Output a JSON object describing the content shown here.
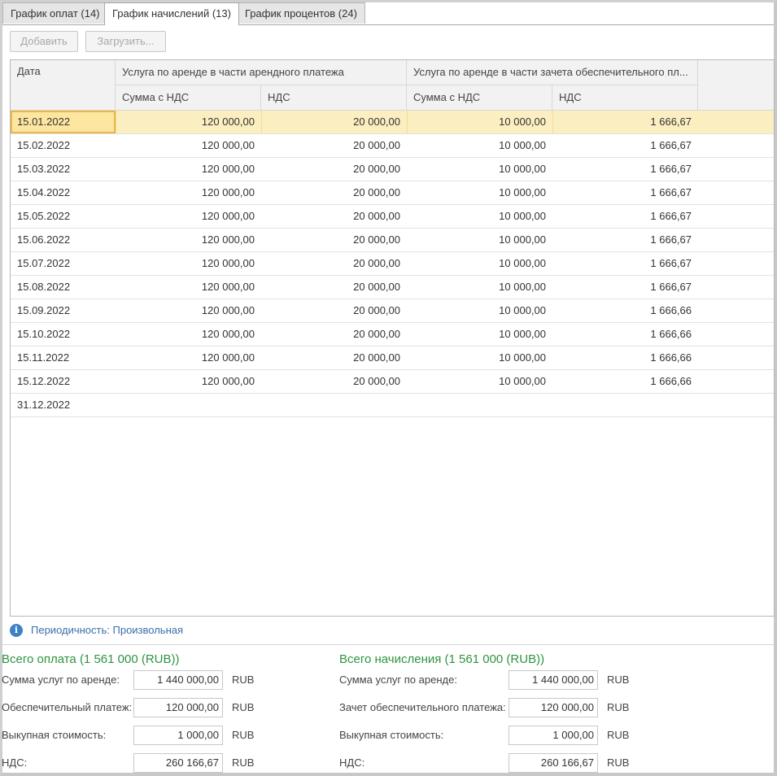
{
  "tabs": [
    {
      "label": "График оплат (14)",
      "active": false
    },
    {
      "label": "График начислений (13)",
      "active": true
    },
    {
      "label": "График процентов (24)",
      "active": false
    }
  ],
  "toolbar": {
    "add_label": "Добавить",
    "load_label": "Загрузить..."
  },
  "table": {
    "header": {
      "date": "Дата",
      "group1": "Услуга по аренде в части арендного платежа",
      "group2": "Услуга по аренде в части зачета обеспечительного пл...",
      "sum_vat": "Сумма с НДС",
      "vat": "НДС"
    },
    "rows": [
      {
        "date": "15.01.2022",
        "c1": "120 000,00",
        "c2": "20 000,00",
        "c3": "10 000,00",
        "c4": "1 666,67"
      },
      {
        "date": "15.02.2022",
        "c1": "120 000,00",
        "c2": "20 000,00",
        "c3": "10 000,00",
        "c4": "1 666,67"
      },
      {
        "date": "15.03.2022",
        "c1": "120 000,00",
        "c2": "20 000,00",
        "c3": "10 000,00",
        "c4": "1 666,67"
      },
      {
        "date": "15.04.2022",
        "c1": "120 000,00",
        "c2": "20 000,00",
        "c3": "10 000,00",
        "c4": "1 666,67"
      },
      {
        "date": "15.05.2022",
        "c1": "120 000,00",
        "c2": "20 000,00",
        "c3": "10 000,00",
        "c4": "1 666,67"
      },
      {
        "date": "15.06.2022",
        "c1": "120 000,00",
        "c2": "20 000,00",
        "c3": "10 000,00",
        "c4": "1 666,67"
      },
      {
        "date": "15.07.2022",
        "c1": "120 000,00",
        "c2": "20 000,00",
        "c3": "10 000,00",
        "c4": "1 666,67"
      },
      {
        "date": "15.08.2022",
        "c1": "120 000,00",
        "c2": "20 000,00",
        "c3": "10 000,00",
        "c4": "1 666,67"
      },
      {
        "date": "15.09.2022",
        "c1": "120 000,00",
        "c2": "20 000,00",
        "c3": "10 000,00",
        "c4": "1 666,66"
      },
      {
        "date": "15.10.2022",
        "c1": "120 000,00",
        "c2": "20 000,00",
        "c3": "10 000,00",
        "c4": "1 666,66"
      },
      {
        "date": "15.11.2022",
        "c1": "120 000,00",
        "c2": "20 000,00",
        "c3": "10 000,00",
        "c4": "1 666,66"
      },
      {
        "date": "15.12.2022",
        "c1": "120 000,00",
        "c2": "20 000,00",
        "c3": "10 000,00",
        "c4": "1 666,66"
      },
      {
        "date": "31.12.2022",
        "c1": "",
        "c2": "",
        "c3": "",
        "c4": ""
      }
    ]
  },
  "info": {
    "text": "Периодичность: Произвольная",
    "icon": "info-icon"
  },
  "payments": {
    "title": "Всего оплата (1 561 000 (RUB))",
    "fields": [
      {
        "label": "Сумма услуг по аренде:",
        "value": "1 440 000,00",
        "currency": "RUB"
      },
      {
        "label": "Обеспечительный платеж:",
        "value": "120 000,00",
        "currency": "RUB"
      },
      {
        "label": "Выкупная стоимость:",
        "value": "1 000,00",
        "currency": "RUB"
      },
      {
        "label": "НДС:",
        "value": "260 166,67",
        "currency": "RUB"
      }
    ]
  },
  "accruals": {
    "title": "Всего начисления (1 561 000 (RUB))",
    "fields": [
      {
        "label": "Сумма услуг по аренде:",
        "value": "1 440 000,00",
        "currency": "RUB"
      },
      {
        "label": "Зачет обеспечительного платежа:",
        "value": "120 000,00",
        "currency": "RUB"
      },
      {
        "label": "Выкупная стоимость:",
        "value": "1 000,00",
        "currency": "RUB"
      },
      {
        "label": "НДС:",
        "value": "260 166,67",
        "currency": "RUB"
      }
    ]
  },
  "colors": {
    "accent_green": "#2e9440",
    "selection": "#fbeec0",
    "info_blue": "#3d82c6"
  }
}
